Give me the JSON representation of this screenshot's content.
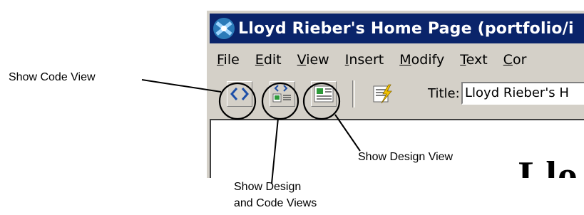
{
  "window": {
    "title": "Lloyd Rieber's Home Page (portfolio/i"
  },
  "menu": {
    "items": [
      {
        "mnemonic": "F",
        "rest": "ile"
      },
      {
        "mnemonic": "E",
        "rest": "dit"
      },
      {
        "mnemonic": "V",
        "rest": "iew"
      },
      {
        "mnemonic": "I",
        "rest": "nsert"
      },
      {
        "mnemonic": "M",
        "rest": "odify"
      },
      {
        "mnemonic": "T",
        "rest": "ext"
      },
      {
        "mnemonic": "C",
        "rest": "or"
      }
    ]
  },
  "toolbar": {
    "title_label": "Title:",
    "title_value": "Lloyd Rieber's H"
  },
  "document": {
    "heading_fragment": "Llo"
  },
  "callouts": {
    "code_view": "Show Code View",
    "design_view": "Show Design View",
    "design_and_code_line1": "Show Design",
    "design_and_code_line2": "and Code Views"
  },
  "colors": {
    "title_bar": "#0a246a",
    "chrome": "#d4d0c8"
  },
  "icons": [
    "app-icon",
    "code-view-icon",
    "split-view-icon",
    "design-view-icon",
    "validate-icon"
  ]
}
